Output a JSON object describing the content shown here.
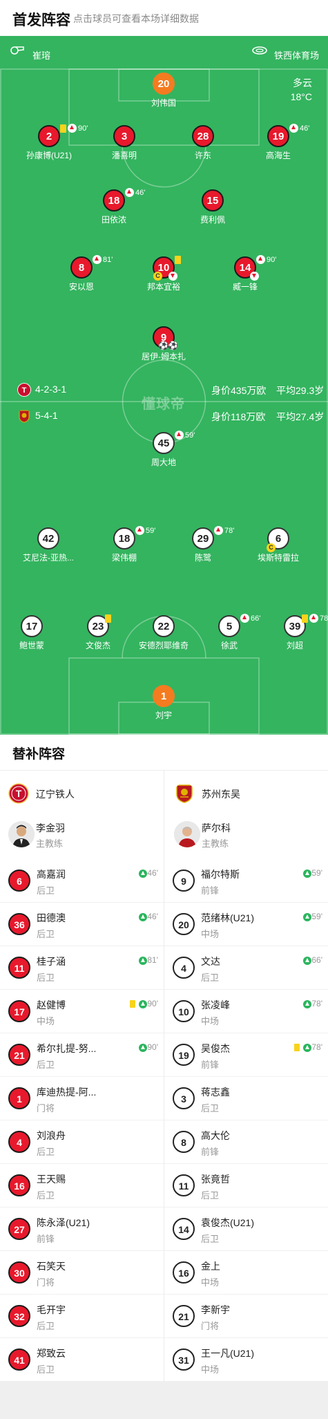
{
  "header": {
    "title": "首发阵容",
    "subtitle": "点击球员可查看本场详细数据"
  },
  "match": {
    "referee": "崔瑢",
    "venue": "铁西体育场",
    "weather": "多云",
    "temperature": "18°C",
    "watermark": "懂球帝"
  },
  "home_team": {
    "name": "辽宁铁人",
    "formation": "4-2-3-1",
    "value": "身价435万欧",
    "avg_age": "平均29.3岁",
    "color": "#e8192c"
  },
  "away_team": {
    "name": "苏州东吴",
    "formation": "5-4-1",
    "value": "身价118万欧",
    "avg_age": "平均27.4岁",
    "color": "#ffffff"
  },
  "home_lineup": [
    {
      "number": "20",
      "name": "刘伟国",
      "captain": true
    },
    {
      "number": "2",
      "name": "孙康博(U21)",
      "yellow": true,
      "sub_minute": "90'"
    },
    {
      "number": "3",
      "name": "潘喜明"
    },
    {
      "number": "28",
      "name": "许东"
    },
    {
      "number": "19",
      "name": "高海生",
      "sub_minute": "46'"
    },
    {
      "number": "18",
      "name": "田依浓",
      "sub_minute": "46'"
    },
    {
      "number": "15",
      "name": "费利佩"
    },
    {
      "number": "8",
      "name": "安以恩",
      "sub_minute": "81'"
    },
    {
      "number": "10",
      "name": "邦本宜裕",
      "yellow": true,
      "captain_badge": "C"
    },
    {
      "number": "14",
      "name": "臧一锋",
      "sub_minute": "90'"
    },
    {
      "number": "9",
      "name": "居伊-姆本扎",
      "goals": "⚽⚽"
    }
  ],
  "away_lineup": [
    {
      "number": "45",
      "name": "周大地",
      "sub_minute": "59'"
    },
    {
      "number": "42",
      "name": "艾尼法-亚热..."
    },
    {
      "number": "18",
      "name": "梁伟棚",
      "sub_minute": "59'"
    },
    {
      "number": "29",
      "name": "陈鹭",
      "sub_minute": "78'"
    },
    {
      "number": "6",
      "name": "埃斯特雷拉",
      "captain_badge": "C"
    },
    {
      "number": "17",
      "name": "鲍世蒙"
    },
    {
      "number": "23",
      "name": "文俊杰",
      "yellow": true
    },
    {
      "number": "22",
      "name": "安德烈耶维奇"
    },
    {
      "number": "5",
      "name": "徐武",
      "sub_minute": "66'"
    },
    {
      "number": "39",
      "name": "刘超",
      "yellow": true,
      "sub_minute": "78'"
    },
    {
      "number": "1",
      "name": "刘宇",
      "captain": true
    }
  ],
  "subs": {
    "title": "替补阵容",
    "home_coach": {
      "name": "李金羽",
      "role": "主教练"
    },
    "away_coach": {
      "name": "萨尔科",
      "role": "主教练"
    },
    "home": [
      {
        "number": "6",
        "name": "高嘉润",
        "position": "后卫",
        "in": "46'"
      },
      {
        "number": "36",
        "name": "田德澳",
        "position": "后卫",
        "in": "46'"
      },
      {
        "number": "11",
        "name": "桂子涵",
        "position": "后卫",
        "in": "81'"
      },
      {
        "number": "17",
        "name": "赵健博",
        "position": "中场",
        "in": "90'",
        "yellow": true
      },
      {
        "number": "21",
        "name": "希尔扎提-努...",
        "position": "后卫",
        "in": "90'"
      },
      {
        "number": "1",
        "name": "库迪热提-阿...",
        "position": "门将"
      },
      {
        "number": "4",
        "name": "刘浪舟",
        "position": "后卫"
      },
      {
        "number": "16",
        "name": "王天赐",
        "position": "后卫"
      },
      {
        "number": "27",
        "name": "陈永泽(U21)",
        "position": "前锋"
      },
      {
        "number": "30",
        "name": "石笑天",
        "position": "门将"
      },
      {
        "number": "32",
        "name": "毛开宇",
        "position": "后卫"
      },
      {
        "number": "41",
        "name": "郑致云",
        "position": "后卫"
      }
    ],
    "away": [
      {
        "number": "9",
        "name": "福尔特斯",
        "position": "前锋",
        "in": "59'"
      },
      {
        "number": "20",
        "name": "范绪林(U21)",
        "position": "中场",
        "in": "59'"
      },
      {
        "number": "4",
        "name": "文达",
        "position": "后卫",
        "in": "66'"
      },
      {
        "number": "10",
        "name": "张凌峰",
        "position": "中场",
        "in": "78'"
      },
      {
        "number": "19",
        "name": "吴俊杰",
        "position": "前锋",
        "in": "78'",
        "yellow": true
      },
      {
        "number": "3",
        "name": "蒋志鑫",
        "position": "后卫"
      },
      {
        "number": "8",
        "name": "高大伦",
        "position": "前锋"
      },
      {
        "number": "11",
        "name": "张竟哲",
        "position": "后卫"
      },
      {
        "number": "14",
        "name": "袁俊杰(U21)",
        "position": "后卫"
      },
      {
        "number": "16",
        "name": "金上",
        "position": "中场"
      },
      {
        "number": "21",
        "name": "李新宇",
        "position": "门将"
      },
      {
        "number": "31",
        "name": "王一凡(U21)",
        "position": "中场"
      }
    ]
  }
}
